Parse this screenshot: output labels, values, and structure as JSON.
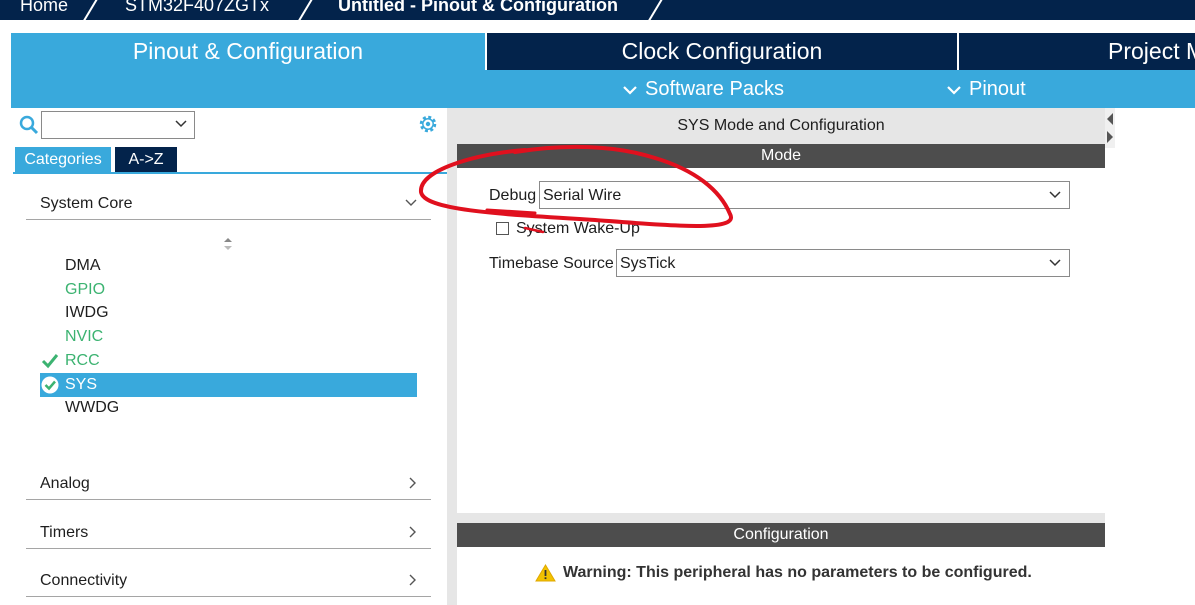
{
  "breadcrumb": {
    "items": [
      "Home",
      "STM32F407ZGTx",
      "Untitled - Pinout & Configuration"
    ]
  },
  "main_tabs": [
    {
      "label": "Pinout & Configuration",
      "active": true
    },
    {
      "label": "Clock Configuration",
      "active": false
    },
    {
      "label": "Project M",
      "active": false
    }
  ],
  "sub_menus": [
    {
      "label": "Software Packs",
      "icon": "chevron-down-icon"
    },
    {
      "label": "Pinout",
      "icon": "chevron-down-icon"
    }
  ],
  "left_panel": {
    "search": {
      "value": "",
      "icon": "search-icon"
    },
    "settings_icon": "gear-icon",
    "view_tabs": [
      {
        "label": "Categories",
        "active": true
      },
      {
        "label": "A->Z",
        "active": false
      }
    ],
    "sections": [
      {
        "label": "System Core",
        "expanded": true
      },
      {
        "label": "Analog",
        "expanded": false
      },
      {
        "label": "Timers",
        "expanded": false
      },
      {
        "label": "Connectivity",
        "expanded": false
      }
    ],
    "system_core_items": [
      {
        "label": "DMA",
        "status": "none",
        "color": "#1e1e1e"
      },
      {
        "label": "GPIO",
        "status": "none",
        "color": "#3cb371"
      },
      {
        "label": "IWDG",
        "status": "none",
        "color": "#1e1e1e"
      },
      {
        "label": "NVIC",
        "status": "none",
        "color": "#3cb371"
      },
      {
        "label": "RCC",
        "status": "configured",
        "color": "#3cb371"
      },
      {
        "label": "SYS",
        "status": "selected-configured",
        "color": "#ffffff"
      },
      {
        "label": "WWDG",
        "status": "none",
        "color": "#1e1e1e"
      }
    ]
  },
  "right_panel": {
    "title": "SYS Mode and Configuration",
    "mode_header": "Mode",
    "debug": {
      "label": "Debug",
      "value": "Serial Wire"
    },
    "wakeup": {
      "label": "System Wake-Up",
      "checked": false
    },
    "timebase": {
      "label": "Timebase Source",
      "value": "SysTick"
    },
    "config_header": "Configuration",
    "warning": {
      "icon": "warning-icon",
      "text": "Warning: This peripheral has no parameters to be configured."
    }
  },
  "colors": {
    "navy": "#03234b",
    "accent": "#39a9dc",
    "band": "#4d4d4d",
    "annotation": "#e0101e",
    "ok_green": "#3cb371"
  }
}
